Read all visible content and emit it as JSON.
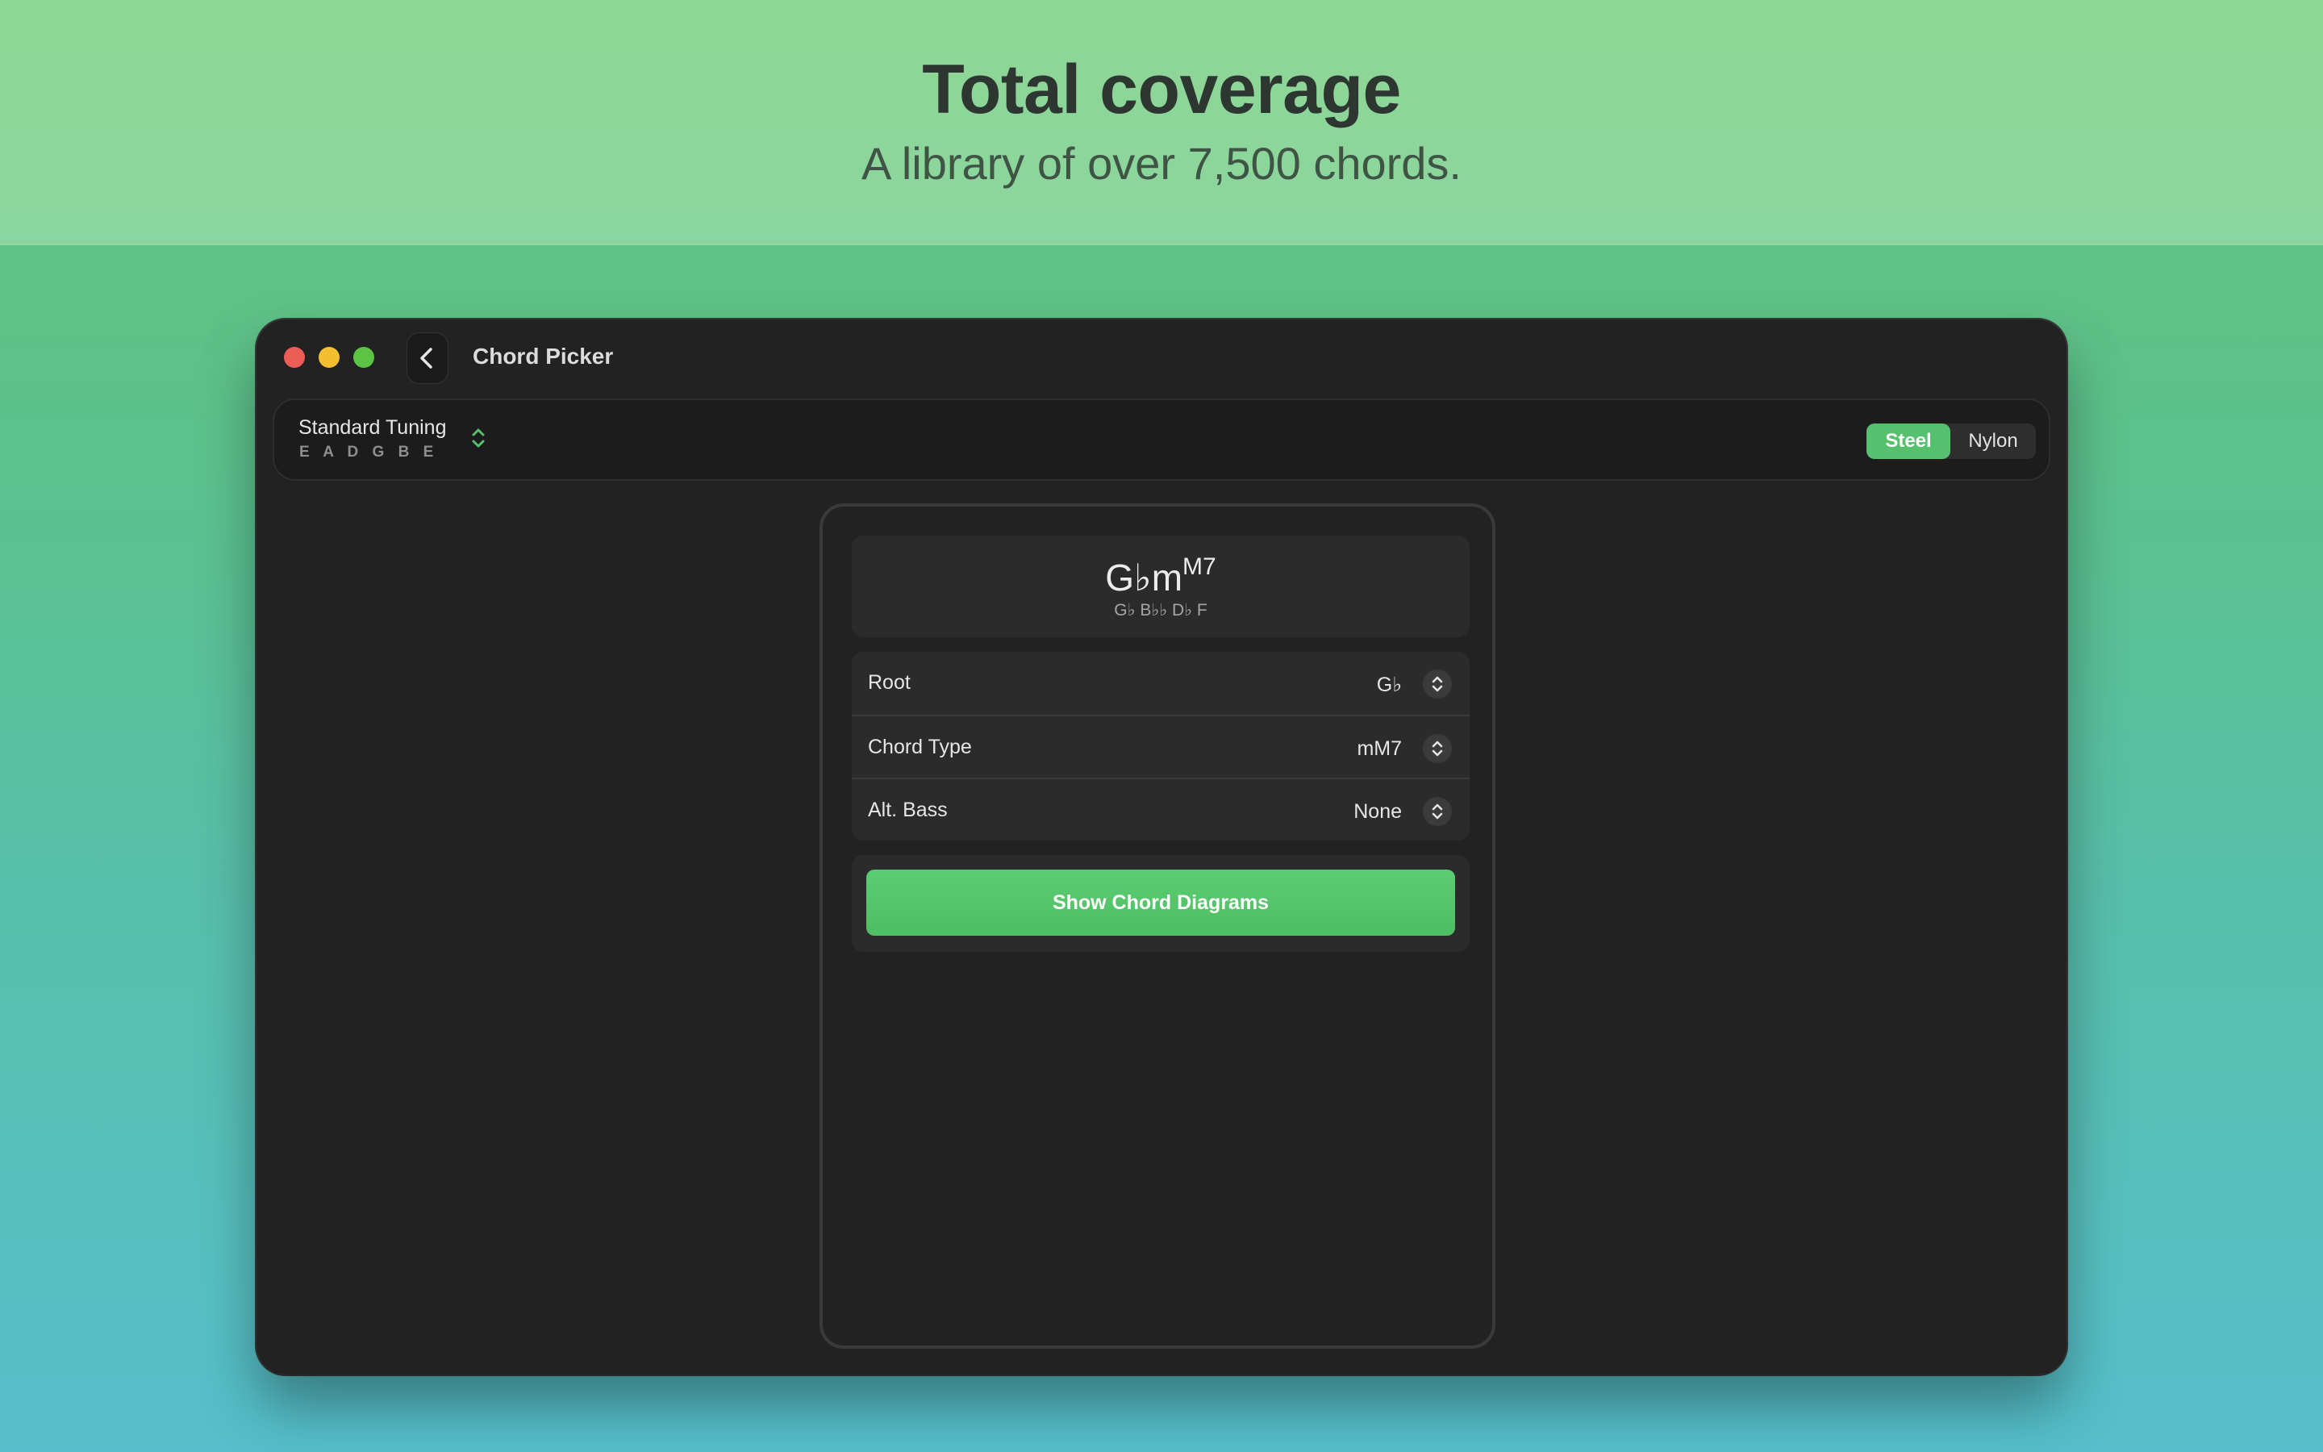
{
  "banner": {
    "title": "Total coverage",
    "subtitle": "A library of over 7,500 chords."
  },
  "window": {
    "title": "Chord Picker"
  },
  "toolbar": {
    "tuning_name": "Standard Tuning",
    "tuning_notes": "EADGBE",
    "string_types": [
      "Steel",
      "Nylon"
    ],
    "selected_string_type": "Steel"
  },
  "chord": {
    "base": "G♭m",
    "superscript": "M7",
    "notes": "G♭ B♭♭ D♭ F"
  },
  "settings": {
    "rows": [
      {
        "label": "Root",
        "value": "G♭"
      },
      {
        "label": "Chord Type",
        "value": "mM7"
      },
      {
        "label": "Alt. Bass",
        "value": "None"
      }
    ]
  },
  "actions": {
    "show_diagrams_label": "Show Chord Diagrams"
  },
  "colors": {
    "accent": "#55c06d",
    "window_bg": "#222222"
  }
}
